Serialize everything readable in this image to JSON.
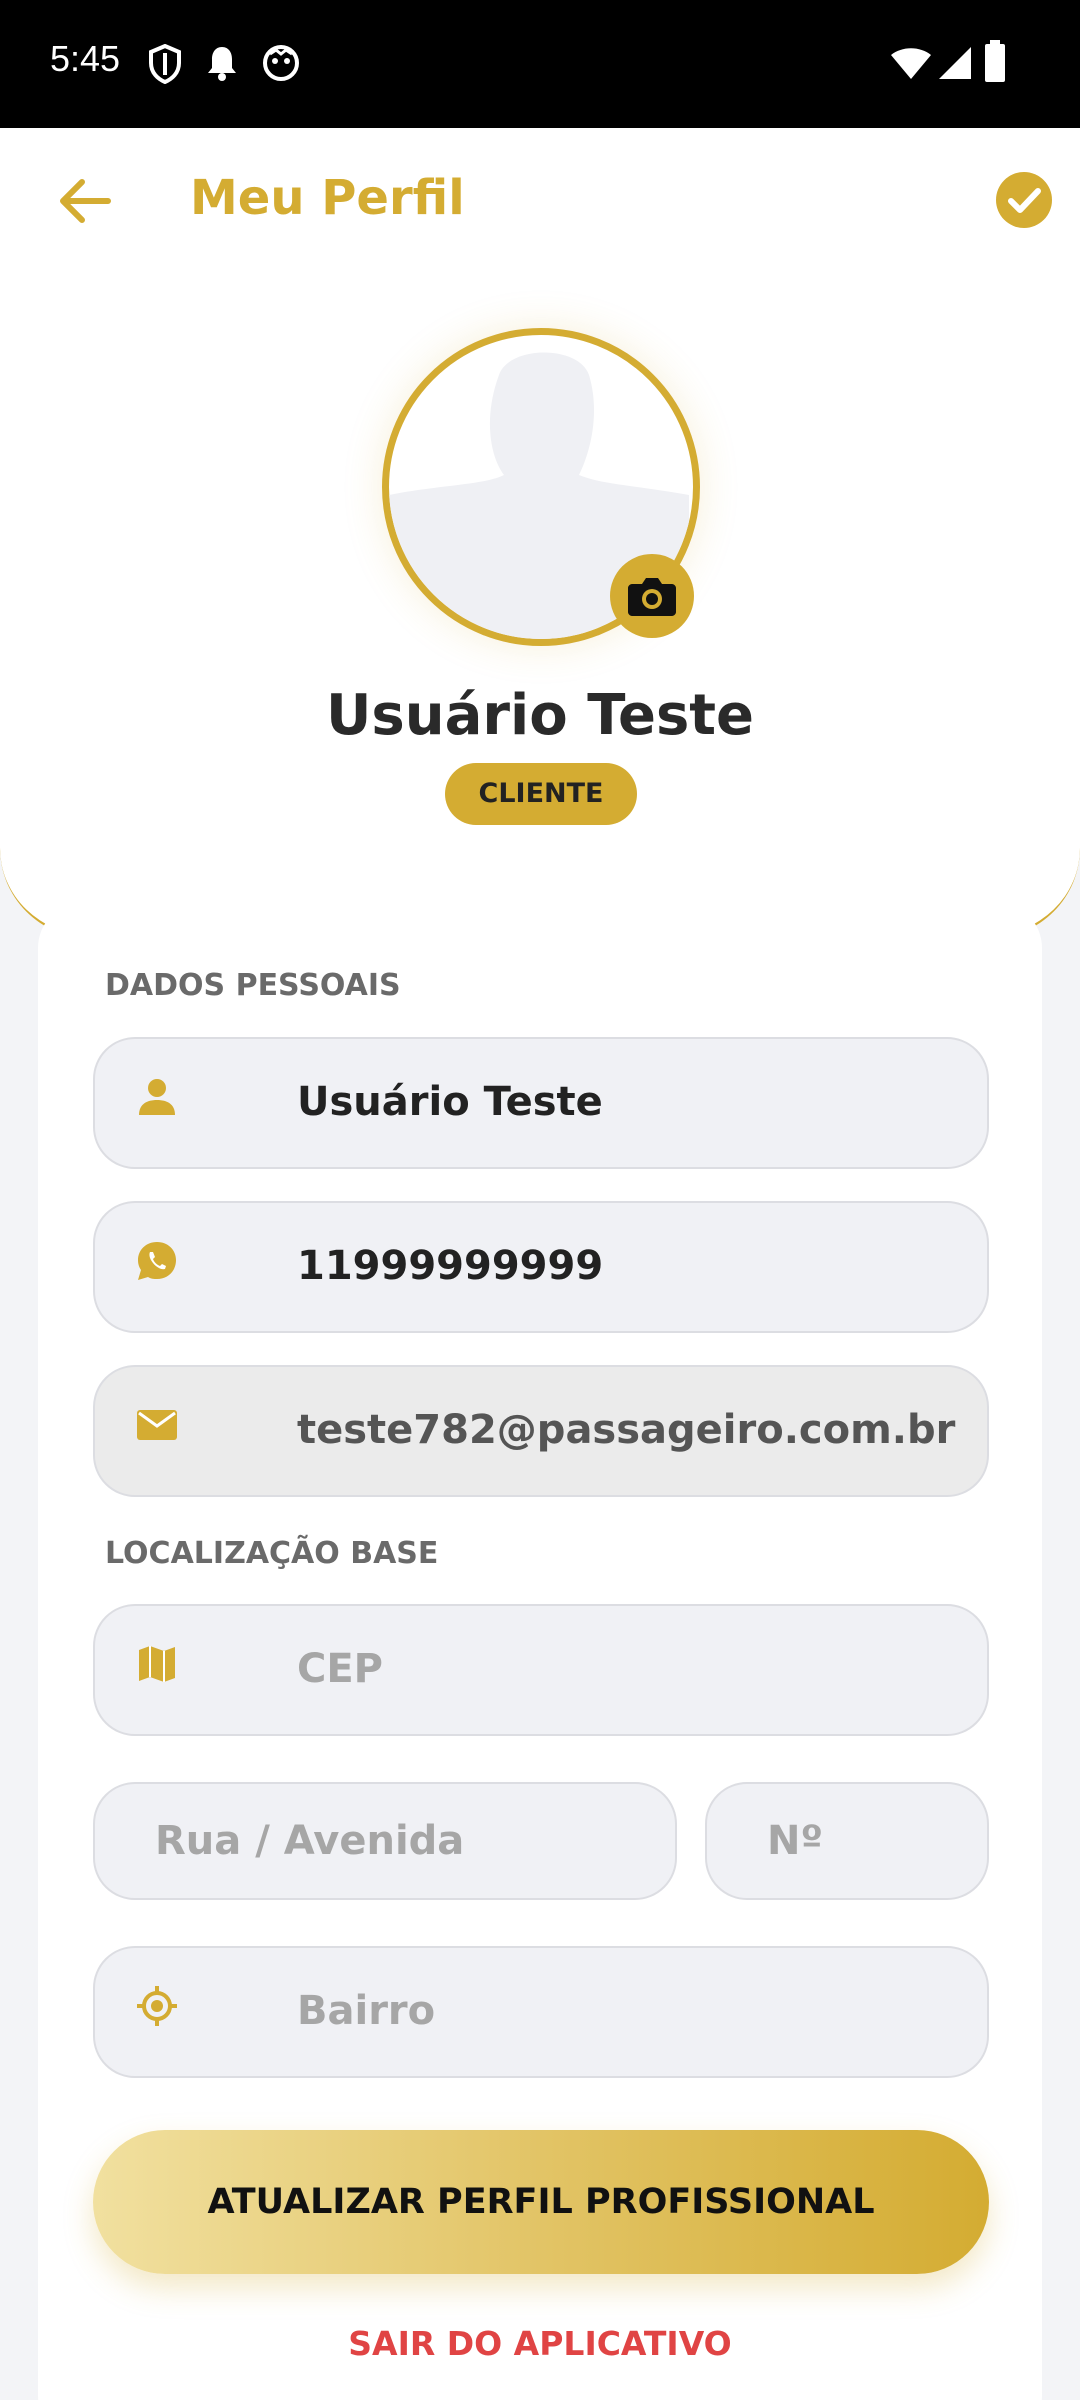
{
  "status_bar": {
    "time": "5:45"
  },
  "header": {
    "title": "Meu Perfil"
  },
  "profile": {
    "name": "Usuário Teste",
    "role_badge": "CLIENTE"
  },
  "personal": {
    "section_label": "DADOS PESSOAIS",
    "name_value": "Usuário Teste",
    "phone_value": "11999999999",
    "email_value": "teste782@passageiro.com.br"
  },
  "location": {
    "section_label": "LOCALIZAÇÃO BASE",
    "cep_placeholder": "CEP",
    "street_placeholder": "Rua / Avenida",
    "number_placeholder": "Nº",
    "district_placeholder": "Bairro"
  },
  "actions": {
    "update_label": "ATUALIZAR PERFIL PROFISSIONAL",
    "logout_label": "SAIR DO APLICATIVO"
  },
  "colors": {
    "accent": "#d4ac32",
    "danger": "#e04444"
  }
}
